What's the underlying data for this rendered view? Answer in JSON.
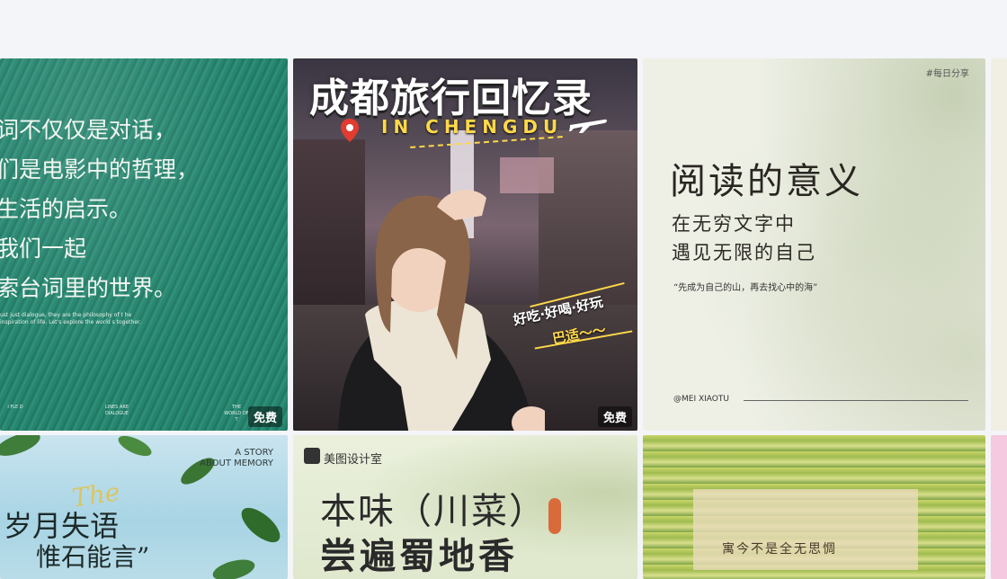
{
  "cards": [
    {
      "id": "movie-lines",
      "lines": [
        "词不仅仅是对话，",
        "们是电影中的哲理，",
        "生活的启示。",
        "我们一起",
        "索台词里的世界。"
      ],
      "english": "ust just dialogue, they are the philosophy of t he inspiration of life. Let's explore the world s together.",
      "footer": [
        "I FLE D",
        "LINES ARE DIALOGUE",
        "THE WORLD OF T"
      ],
      "badge": "免费"
    },
    {
      "id": "chengdu-travel",
      "title": "成都旅行回忆录",
      "subtitle": "IN CHENGDU",
      "tag1": "好吃·好喝·好玩",
      "tag2": "巴适～～",
      "badge": "免费"
    },
    {
      "id": "reading-meaning",
      "hashtag": "#每日分享",
      "title": "阅读的意义",
      "line1": "在无穷文字中",
      "line2": "遇见无限的自己",
      "quote": "“先成为自己的山，再去找心中的海”",
      "author": "@MEI XIAOTU"
    },
    {
      "id": "story-memory",
      "story": [
        "A STORY",
        "ABOUT MEMORY"
      ],
      "script": "The",
      "line1": "岁月失语",
      "line2": "惟石能言”"
    },
    {
      "id": "sichuan-food",
      "brand": "美图设计室",
      "line1": "本味（川菜）",
      "line2": "尝遍蜀地香"
    },
    {
      "id": "bamboo-text",
      "text": "寓今不是全无思惆"
    }
  ],
  "colors": {
    "background": "#f4f5f8",
    "badge": "#000000",
    "accent_yellow": "#ffd84a"
  }
}
